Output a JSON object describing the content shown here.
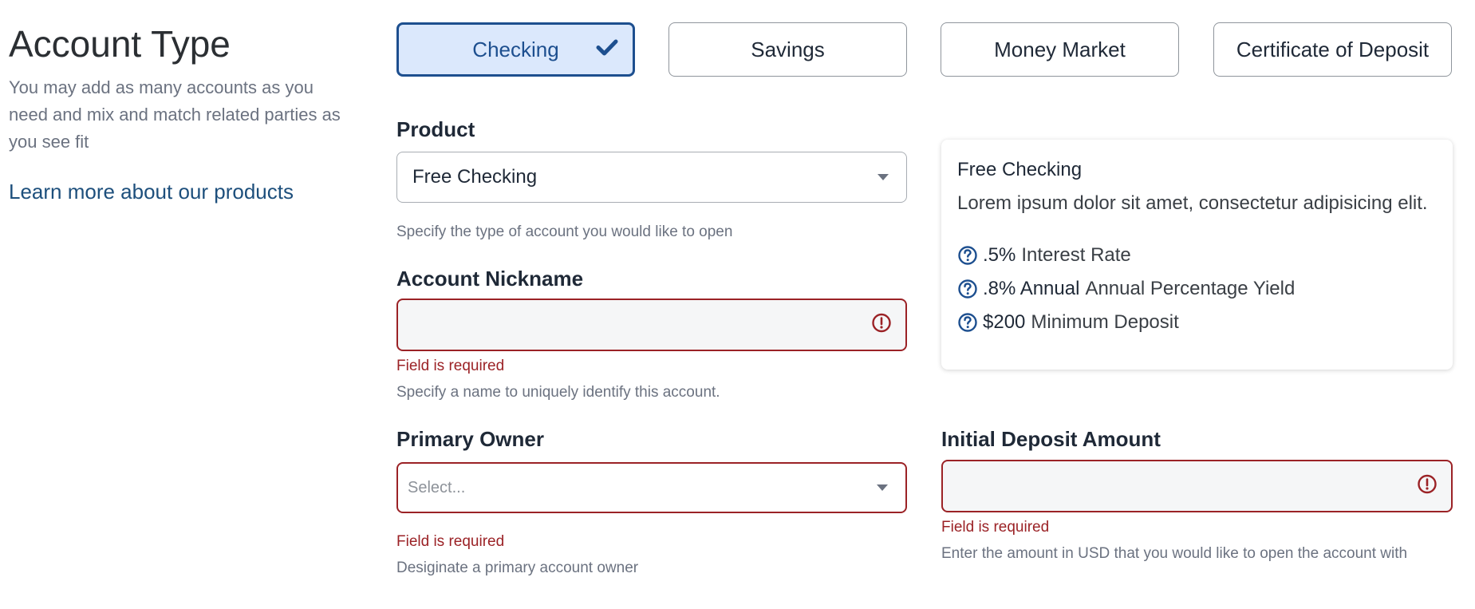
{
  "sidebar": {
    "title": "Account Type",
    "description": "You may add as many accounts as you need and mix and match related parties as you see fit",
    "learn_more": "Learn more about our products"
  },
  "account_types": {
    "checking": "Checking",
    "savings": "Savings",
    "money_market": "Money Market",
    "cd": "Certificate of Deposit",
    "selected": "Checking"
  },
  "product": {
    "label": "Product",
    "value": "Free Checking",
    "help": "Specify the type of account you would like to open"
  },
  "nickname": {
    "label": "Account Nickname",
    "value": "",
    "error": "Field is required",
    "help": "Specify a name to uniquely identify this account."
  },
  "primary_owner": {
    "label": "Primary Owner",
    "placeholder": "Select...",
    "error": "Field is required",
    "help": "Desiginate a primary account owner"
  },
  "initial_deposit": {
    "label": "Initial Deposit Amount",
    "value": "",
    "error": "Field is required",
    "help": "Enter the amount in USD that you would like to open the account with"
  },
  "product_card": {
    "title": "Free Checking",
    "description": "Lorem ipsum dolor sit amet, consectetur adipisicing elit.",
    "features": [
      {
        "value": ".5%",
        "label": "Interest Rate"
      },
      {
        "value": ".8% Annual",
        "label": "Annual Percentage Yield"
      },
      {
        "value": "$200",
        "label": "Minimum Deposit"
      }
    ]
  },
  "colors": {
    "accent": "#1d4f8f",
    "selected_bg": "#dbe8fc",
    "error": "#9b2226",
    "link": "#1d4f7c"
  },
  "icons": [
    "check-icon",
    "chevron-down-icon",
    "alert-circle-icon",
    "question-circle-icon"
  ]
}
